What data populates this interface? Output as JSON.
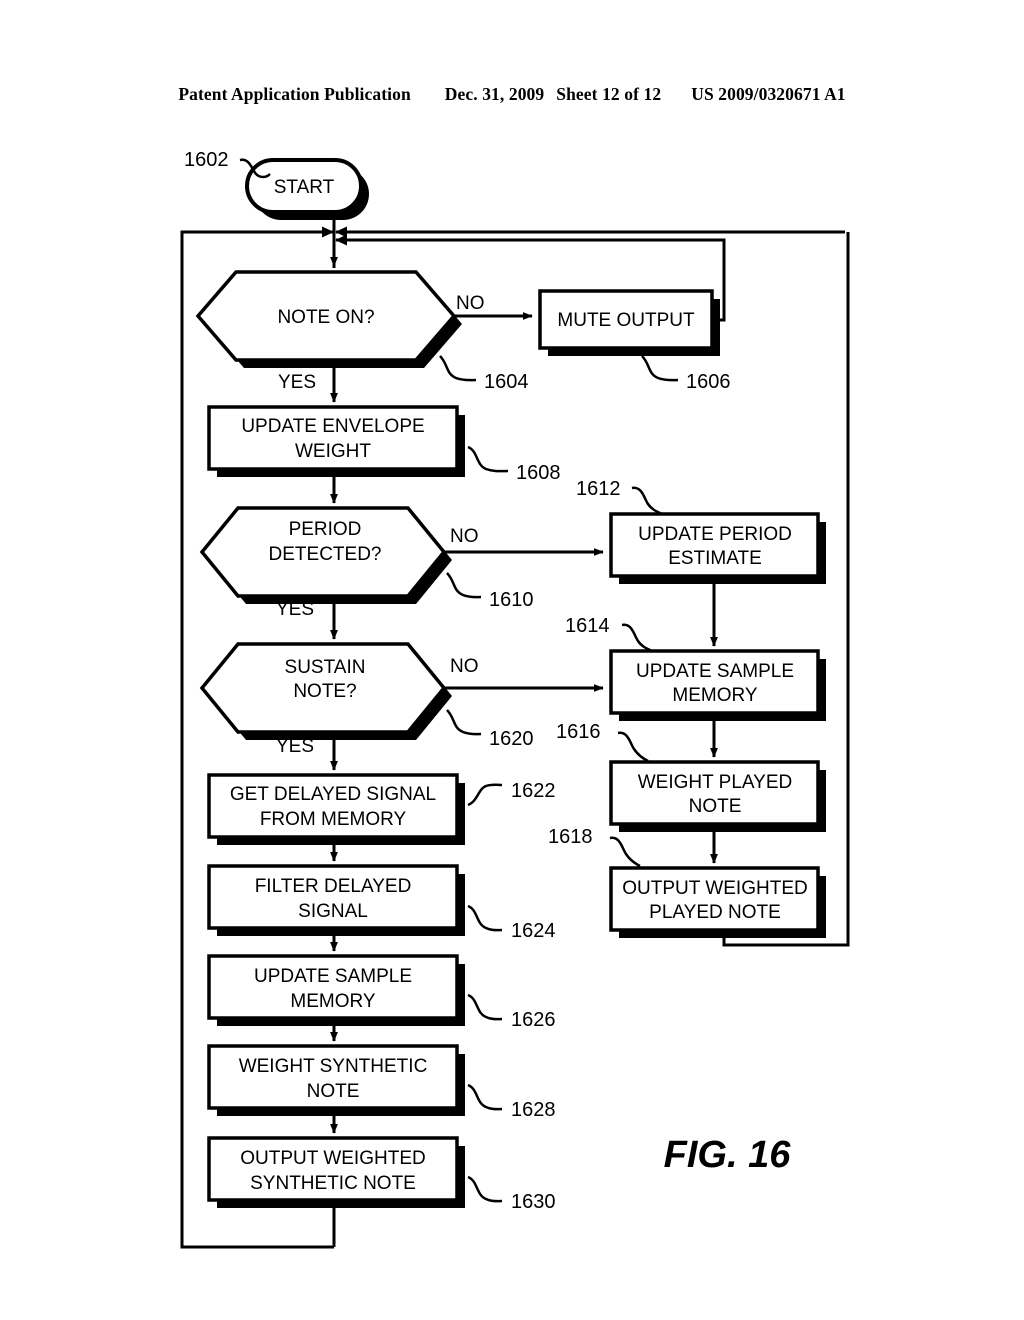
{
  "header": {
    "publication": "Patent Application Publication",
    "date": "Dec. 31, 2009",
    "sheet": "Sheet 12 of 12",
    "patent_number": "US 2009/0320671 A1"
  },
  "figure": {
    "label": "FIG. 16"
  },
  "nodes": {
    "start": {
      "label": "START",
      "ref": "1602"
    },
    "note_on": {
      "label_line1": "NOTE ON?",
      "ref": "1604"
    },
    "mute_output": {
      "label_line1": "MUTE OUTPUT",
      "ref": "1606"
    },
    "update_envelope_weight": {
      "label_line1": "UPDATE ENVELOPE",
      "label_line2": "WEIGHT",
      "ref": "1608"
    },
    "period_detected": {
      "label_line1": "PERIOD",
      "label_line2": "DETECTED?",
      "ref": "1610"
    },
    "update_period_estimate": {
      "label_line1": "UPDATE PERIOD",
      "label_line2": "ESTIMATE",
      "ref": "1612"
    },
    "update_sample_memory_right": {
      "label_line1": "UPDATE SAMPLE",
      "label_line2": "MEMORY",
      "ref": "1614"
    },
    "weight_played_note": {
      "label_line1": "WEIGHT PLAYED",
      "label_line2": "NOTE",
      "ref": "1616"
    },
    "output_weighted_played_note": {
      "label_line1": "OUTPUT WEIGHTED",
      "label_line2": "PLAYED NOTE",
      "ref": "1618"
    },
    "sustain_note": {
      "label_line1": "SUSTAIN",
      "label_line2": "NOTE?",
      "ref": "1620"
    },
    "get_delayed_signal": {
      "label_line1": "GET DELAYED SIGNAL",
      "label_line2": "FROM MEMORY",
      "ref": "1622"
    },
    "filter_delayed_signal": {
      "label_line1": "FILTER DELAYED",
      "label_line2": "SIGNAL",
      "ref": "1624"
    },
    "update_sample_memory_left": {
      "label_line1": "UPDATE SAMPLE",
      "label_line2": "MEMORY",
      "ref": "1626"
    },
    "weight_synthetic_note": {
      "label_line1": "WEIGHT SYNTHETIC",
      "label_line2": "NOTE",
      "ref": "1628"
    },
    "output_weighted_synthetic_note": {
      "label_line1": "OUTPUT WEIGHTED",
      "label_line2": "SYNTHETIC NOTE",
      "ref": "1630"
    }
  },
  "edge_labels": {
    "note_on_no": "NO",
    "note_on_yes": "YES",
    "period_detected_no": "NO",
    "period_detected_yes": "YES",
    "sustain_note_no": "NO",
    "sustain_note_yes": "YES"
  },
  "colors": {
    "ink": "#000000",
    "paper": "#ffffff"
  }
}
